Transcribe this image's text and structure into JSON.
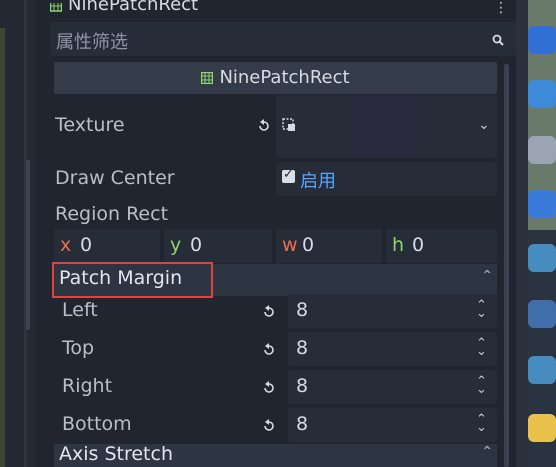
{
  "inspector": {
    "node_title": "NinePatchRect",
    "filter_placeholder": "属性筛选",
    "class_header": "NinePatchRect"
  },
  "properties": {
    "texture_label": "Texture",
    "draw_center_label": "Draw Center",
    "draw_center_value_label": "启用",
    "draw_center_checked": true,
    "region_rect_label": "Region Rect",
    "region_rect": [
      {
        "axis": "x",
        "value": "0",
        "color": "#e8704a"
      },
      {
        "axis": "y",
        "value": "0",
        "color": "#8fd46e"
      },
      {
        "axis": "w",
        "value": "0",
        "color": "#e8704a"
      },
      {
        "axis": "h",
        "value": "0",
        "color": "#8fd46e"
      }
    ]
  },
  "patch_margin": {
    "section_label": "Patch Margin",
    "rows": [
      {
        "label": "Left",
        "value": "8"
      },
      {
        "label": "Top",
        "value": "8"
      },
      {
        "label": "Right",
        "value": "8"
      },
      {
        "label": "Bottom",
        "value": "8"
      }
    ]
  },
  "axis_stretch": {
    "section_label": "Axis Stretch"
  },
  "colors": {
    "accent": "#57a6ff",
    "highlight": "#e0443e",
    "panel": "#202530",
    "field": "#262c38"
  }
}
